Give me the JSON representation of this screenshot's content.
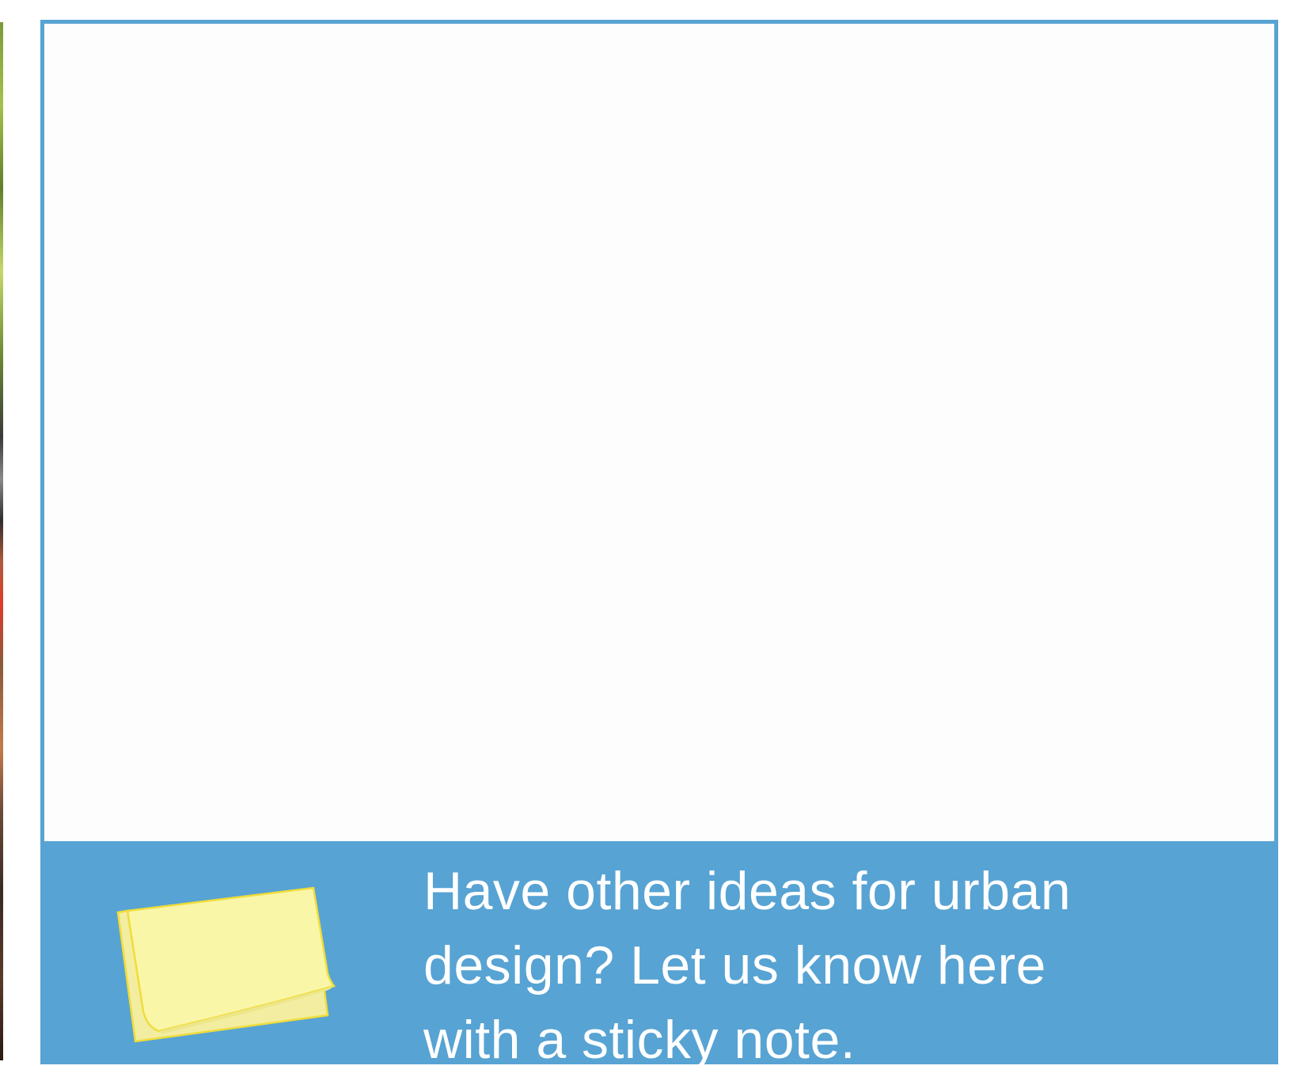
{
  "cta": {
    "text": "Have other ideas for urban design? Let us know here with a sticky note."
  },
  "icons": {
    "sticky_note": "sticky-note-icon"
  },
  "colors": {
    "accent": "#57a3d3",
    "card_background": "#fdfdfd",
    "sticky_note_fill": "#f9f6a8",
    "sticky_note_stroke": "#f0dc3a",
    "cta_text": "#ffffff"
  }
}
